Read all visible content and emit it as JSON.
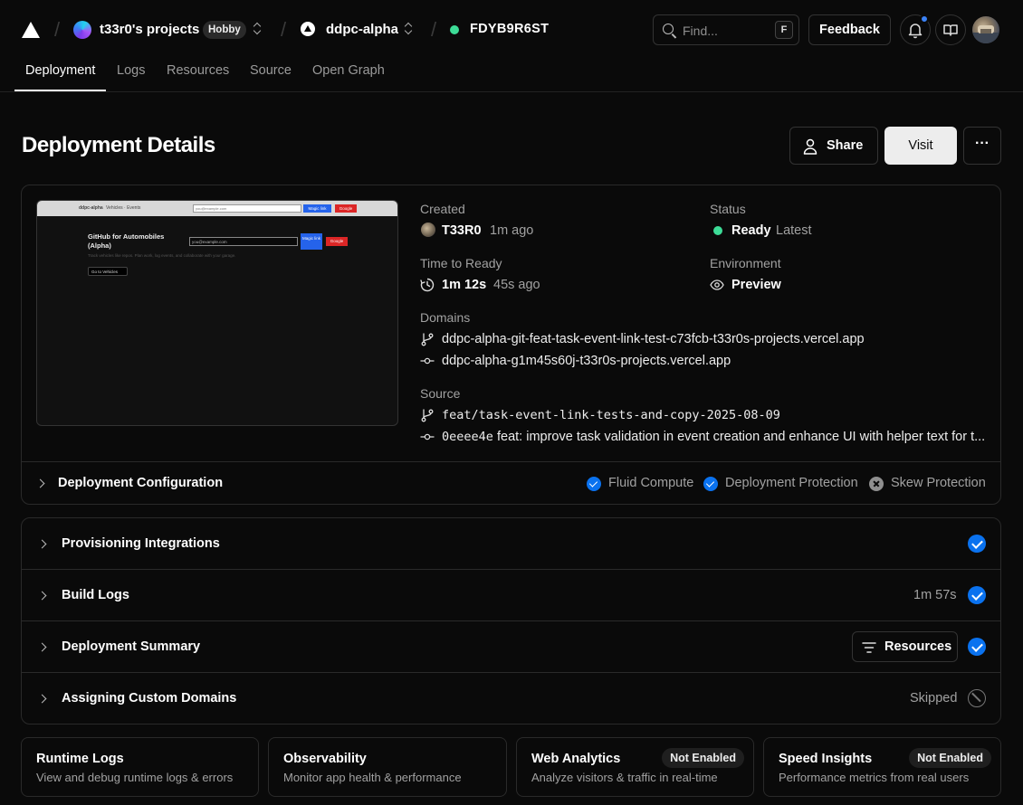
{
  "nav": {
    "team_name": "t33r0's projects",
    "plan_badge": "Hobby",
    "project_name": "ddpc-alpha",
    "deployment_id": "FDYB9R6ST",
    "find_placeholder": "Find...",
    "find_shortcut": "F",
    "feedback_label": "Feedback"
  },
  "tabs": [
    "Deployment",
    "Logs",
    "Resources",
    "Source",
    "Open Graph"
  ],
  "header": {
    "title": "Deployment Details",
    "share_label": "Share",
    "visit_label": "Visit",
    "more_label": "···"
  },
  "preview": {
    "nav_brand": "ddpc-alpha",
    "nav_links": "Vehicles · Events",
    "email_placeholder": "you@example.com",
    "magic_link": "Magic link",
    "google": "Google",
    "hero_title": "GitHub for Automobiles (Alpha)",
    "hero_sub": "Track vehicles like repos. Plan work, log events, and collaborate with your garage.",
    "cta": "Go to Vehicles"
  },
  "details": {
    "created_label": "Created",
    "created_user": "T33R0",
    "created_ago": "1m ago",
    "status_label": "Status",
    "status_value": "Ready",
    "status_tag": "Latest",
    "ttr_label": "Time to Ready",
    "ttr_value": "1m 12s",
    "ttr_ago": "45s ago",
    "env_label": "Environment",
    "env_value": "Preview",
    "domains_label": "Domains",
    "domains": [
      "ddpc-alpha-git-feat-task-event-link-test-c73fcb-t33r0s-projects.vercel.app",
      "ddpc-alpha-g1m45s60j-t33r0s-projects.vercel.app"
    ],
    "source_label": "Source",
    "branch": "feat/task-event-link-tests-and-copy-2025-08-09",
    "commit_sha": "0eeee4e",
    "commit_msg": "feat: improve task validation in event creation and enhance UI with helper text for t..."
  },
  "config": {
    "title": "Deployment Configuration",
    "features": [
      {
        "label": "Fluid Compute",
        "enabled": true
      },
      {
        "label": "Deployment Protection",
        "enabled": true
      },
      {
        "label": "Skew Protection",
        "enabled": false
      }
    ]
  },
  "steps": [
    {
      "name": "Provisioning Integrations",
      "right": "",
      "state": "done"
    },
    {
      "name": "Build Logs",
      "right": "1m 57s",
      "state": "done"
    },
    {
      "name": "Deployment Summary",
      "right": "",
      "button": "Resources",
      "state": "done"
    },
    {
      "name": "Assigning Custom Domains",
      "right": "Skipped",
      "state": "skipped"
    }
  ],
  "bottom_cards": [
    {
      "title": "Runtime Logs",
      "desc": "View and debug runtime logs & errors",
      "badge": ""
    },
    {
      "title": "Observability",
      "desc": "Monitor app health & performance",
      "badge": ""
    },
    {
      "title": "Web Analytics",
      "desc": "Analyze visitors & traffic in real-time",
      "badge": "Not Enabled"
    },
    {
      "title": "Speed Insights",
      "desc": "Performance metrics from real users",
      "badge": "Not Enabled"
    }
  ],
  "colors": {
    "background": "#0a0a0a",
    "ready_green": "#3ddc97",
    "check_blue": "#0a72ef",
    "notification_blue": "#3b82f6"
  }
}
